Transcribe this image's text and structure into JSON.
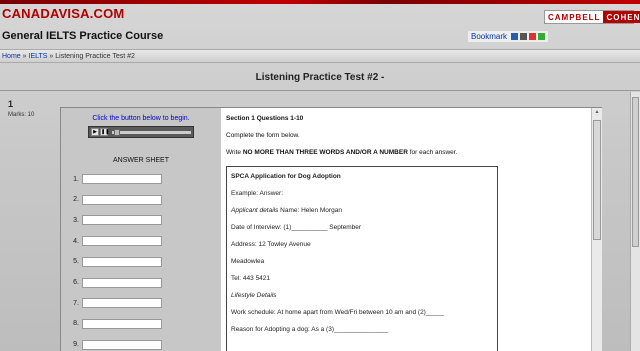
{
  "site": {
    "logo": "CANADAVISA.COM",
    "partner_logo_left": "CAMPBELL",
    "partner_logo_right": "COHEN",
    "course_title": "General IELTS Practice Course",
    "bookmark_label": "Bookmark"
  },
  "breadcrumb": {
    "home": "Home",
    "sep1": "»",
    "section": "IELTS",
    "sep2": "»",
    "current": "Listening Practice Test #2"
  },
  "page_title": "Listening Practice Test #2 -",
  "question": {
    "number": "1",
    "marks": "Marks: 10"
  },
  "left": {
    "click_label": "Click the button below to begin.",
    "answer_sheet_title": "ANSWER SHEET",
    "answer_numbers": [
      "1.",
      "2.",
      "3.",
      "4.",
      "5.",
      "6.",
      "7.",
      "8.",
      "9."
    ]
  },
  "right": {
    "section_heading": "Section 1 Questions 1-10",
    "instruction1": "Complete the form below.",
    "instruction2_prefix": "Write ",
    "instruction2_bold": "NO MORE THAN THREE WORDS AND/OR A NUMBER",
    "instruction2_suffix": " for each answer.",
    "form": {
      "title": "SPCA Application for Dog Adoption",
      "example": "Example: Answer:",
      "applicant_label": "Applicant details",
      "applicant_value": " Name: Helen Morgan",
      "interview": "Date of Interview: (1)__________ September",
      "address1": "Address: 12 Towley Avenue",
      "address2": "Meadowlea",
      "tel": "Tel: 443 5421",
      "lifestyle": "Lifestyle Details",
      "work": "Work schedule: At home apart from Wed/Fri between 10 am and (2)_____",
      "reason": "Reason for Adopting a dog: As a (3)_______________"
    }
  },
  "colors": {
    "brand_red": "#b00000",
    "link_blue": "#0033aa"
  }
}
